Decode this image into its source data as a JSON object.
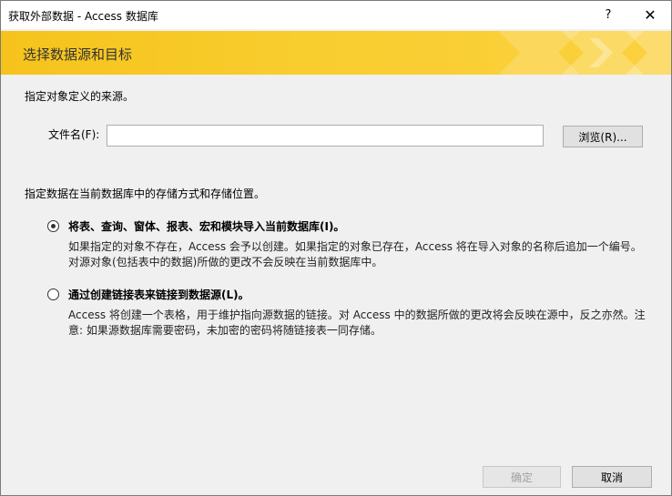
{
  "window": {
    "title": "获取外部数据 - Access 数据库",
    "help_glyph": "?",
    "close_glyph": "✕"
  },
  "banner": {
    "title": "选择数据源和目标"
  },
  "source": {
    "heading": "指定对象定义的来源。",
    "file_label": "文件名(F):",
    "file_value": "",
    "browse_label": "浏览(R)..."
  },
  "storage": {
    "heading": "指定数据在当前数据库中的存储方式和存储位置。",
    "options": [
      {
        "label": "将表、查询、窗体、报表、宏和模块导入当前数据库(I)。",
        "selected": true,
        "desc_line1": "如果指定的对象不存在，Access 会予以创建。如果指定的对象已存在，Access 将在导入对象的名称后追加一个编号。",
        "desc_line2": "对源对象(包括表中的数据)所做的更改不会反映在当前数据库中。"
      },
      {
        "label": "通过创建链接表来链接到数据源(L)。",
        "selected": false,
        "desc_line1": "Access 将创建一个表格，用于维护指向源数据的链接。对 Access 中的数据所做的更改将会反映在源中，反之亦然。注",
        "desc_line2": "意: 如果源数据库需要密码，未加密的密码将随链接表一同存储。"
      }
    ]
  },
  "footer": {
    "ok_label": "确定",
    "cancel_label": "取消"
  },
  "colors": {
    "banner": "#f6c31c",
    "banner_title": "#333333"
  }
}
